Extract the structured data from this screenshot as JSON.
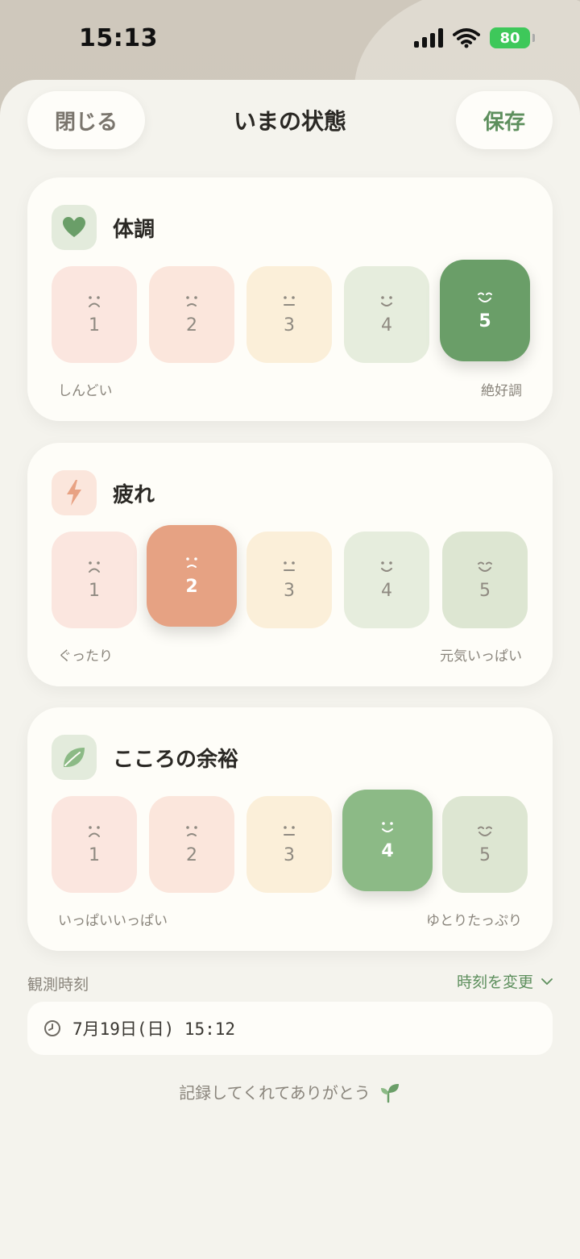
{
  "status_bar": {
    "time": "15:13",
    "battery": "80"
  },
  "header": {
    "close_label": "閉じる",
    "title": "いまの状態",
    "save_label": "保存"
  },
  "cards": [
    {
      "title": "体調",
      "icon": "heart-icon",
      "selected": 5,
      "low_label": "しんどい",
      "high_label": "絶好調",
      "options": [
        "1",
        "2",
        "3",
        "4",
        "5"
      ]
    },
    {
      "title": "疲れ",
      "icon": "lightning-icon",
      "selected": 2,
      "low_label": "ぐったり",
      "high_label": "元気いっぱい",
      "options": [
        "1",
        "2",
        "3",
        "4",
        "5"
      ]
    },
    {
      "title": "こころの余裕",
      "icon": "leaf-icon",
      "selected": 4,
      "low_label": "いっぱいいっぱい",
      "high_label": "ゆとりたっぷり",
      "options": [
        "1",
        "2",
        "3",
        "4",
        "5"
      ]
    }
  ],
  "observation": {
    "label": "観測時刻",
    "change_label": "時刻を変更",
    "datetime": "7月19日(日) 15:12"
  },
  "footer": {
    "thanks": "記録してくれてありがとう"
  },
  "colors": {
    "accent_green": "#5d8f5d",
    "selected_dark_green": "#6a9e68",
    "selected_green": "#8cba86",
    "selected_orange": "#e6a283"
  }
}
